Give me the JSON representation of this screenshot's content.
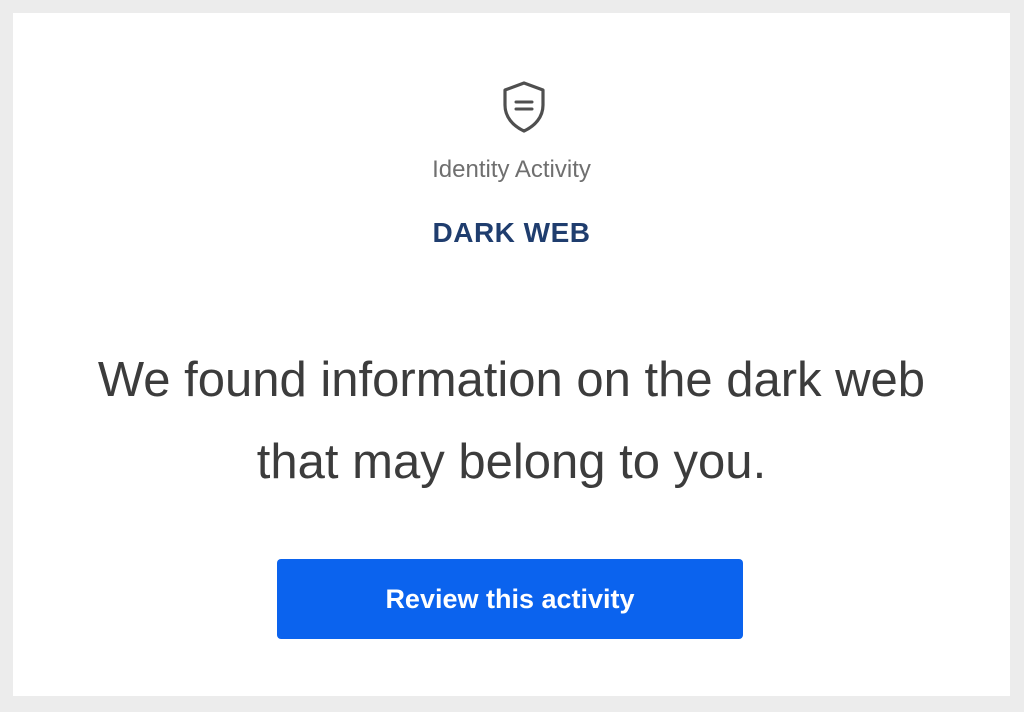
{
  "notification": {
    "icon": "shield-list-icon",
    "eyebrow": "Identity Activity",
    "category": "DARK WEB",
    "headline": "We found information on the dark web that may belong to you.",
    "cta_label": "Review this activity"
  },
  "colors": {
    "page_background": "#ececec",
    "card_background": "#ffffff",
    "category_text": "#1f3d6e",
    "headline_text": "#3c3c3c",
    "button_background": "#0b63ee",
    "button_text": "#ffffff",
    "icon_stroke": "#4f4f4f"
  }
}
